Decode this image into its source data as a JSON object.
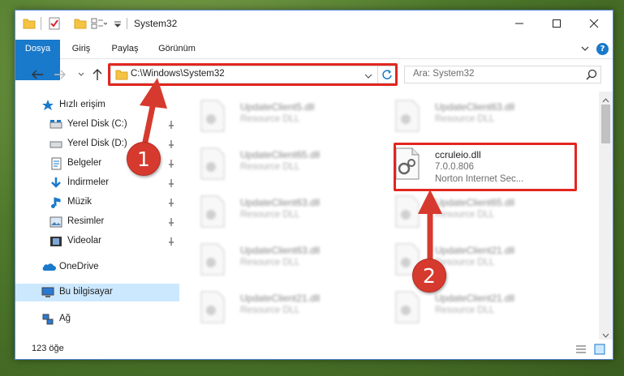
{
  "window": {
    "title": "System32"
  },
  "ribbon": {
    "tabs": [
      "Dosya",
      "Giriş",
      "Paylaş",
      "Görünüm"
    ],
    "help": "?"
  },
  "navigation": {
    "address": "C:\\Windows\\System32",
    "search_placeholder": "Ara: System32"
  },
  "sidebar": {
    "items": [
      {
        "label": "Hızlı erişim",
        "icon": "star-icon",
        "pinned": false
      },
      {
        "label": "Yerel Disk (C:)",
        "icon": "drive-icon",
        "pinned": true
      },
      {
        "label": "Yerel Disk (D:)",
        "icon": "drive-icon",
        "pinned": true
      },
      {
        "label": "Belgeler",
        "icon": "documents-icon",
        "pinned": true
      },
      {
        "label": "İndirmeler",
        "icon": "download-icon",
        "pinned": true
      },
      {
        "label": "Müzik",
        "icon": "music-icon",
        "pinned": true
      },
      {
        "label": "Resimler",
        "icon": "pictures-icon",
        "pinned": true
      },
      {
        "label": "Videolar",
        "icon": "videos-icon",
        "pinned": true
      },
      {
        "label": "OneDrive",
        "icon": "onedrive-icon",
        "pinned": false
      },
      {
        "label": "Bu bilgisayar",
        "icon": "computer-icon",
        "pinned": false,
        "selected": true
      },
      {
        "label": "Ağ",
        "icon": "network-icon",
        "pinned": false
      }
    ]
  },
  "files": [
    {
      "name": "UpdateClient5.dll",
      "type": "Resource DLL",
      "blurred": true
    },
    {
      "name": "UpdateClient63.dll",
      "type": "Resource DLL",
      "blurred": true
    },
    {
      "name": "UpdateClient65.dll",
      "type": "Resource DLL",
      "blurred": true
    },
    {
      "name": "ccruleio.dll",
      "version": "7.0.0.806",
      "type": "Norton Internet Sec...",
      "blurred": false
    },
    {
      "name": "UpdateClient63.dll",
      "type": "Resource DLL",
      "blurred": true
    },
    {
      "name": "UpdateClient65.dll",
      "type": "Resource DLL",
      "blurred": true
    },
    {
      "name": "UpdateClient63.dll",
      "type": "Resource DLL",
      "blurred": true
    },
    {
      "name": "UpdateClient21.dll",
      "type": "Resource DLL",
      "blurred": true
    },
    {
      "name": "UpdateClient21.dll",
      "type": "Resource DLL",
      "blurred": true
    },
    {
      "name": "UpdateClient21.dll",
      "type": "Resource DLL",
      "blurred": true
    }
  ],
  "status": {
    "item_count": "123 öğe"
  },
  "callouts": [
    "1",
    "2"
  ],
  "colors": {
    "accent": "#1979ca",
    "highlight": "#e2261f",
    "selection": "#cce8ff"
  }
}
